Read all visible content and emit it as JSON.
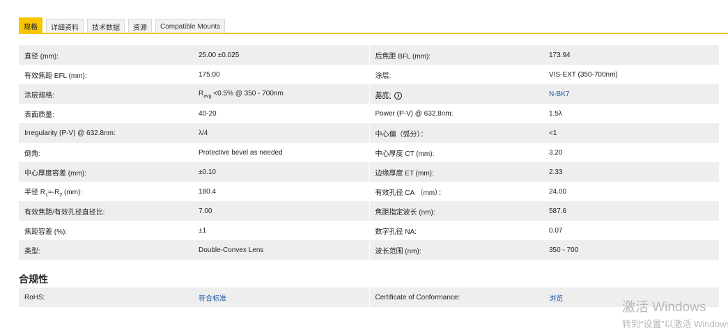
{
  "tabs": [
    {
      "label": "规格"
    },
    {
      "label": "详细资料"
    },
    {
      "label": "技术数据"
    },
    {
      "label": "资源"
    },
    {
      "label": "Compatible Mounts"
    }
  ],
  "spec_rows": [
    {
      "l1": "直径 (mm):",
      "v1": "25.00 ±0.025",
      "l2": "后焦距 BFL (mm):",
      "v2": "173.94"
    },
    {
      "l1": "有效焦距 EFL (mm):",
      "v1": "175.00",
      "l2": "涂层:",
      "v2": "VIS-EXT (350-700nm)"
    },
    {
      "l1": "涂层规格:",
      "v1_r": "R",
      "v1_sub": "avg",
      "v1_rest": " <0.5% @ 350 - 700nm",
      "l2": "基底:",
      "l2_icon": "i",
      "v2": "N-BK7"
    },
    {
      "l1": "表面质量:",
      "v1": "40-20",
      "l2": "Power (P-V) @ 632.8nm:",
      "v2": "1.5λ"
    },
    {
      "l1": "Irregularity (P-V) @ 632.8nm:",
      "v1": "λ/4",
      "l2": "中心偏（弧分）：",
      "v2": "<1"
    },
    {
      "l1": "倒角:",
      "v1": "Protective bevel as needed",
      "l2": "中心厚度 CT (mm):",
      "v2": "3.20"
    },
    {
      "l1": "中心厚度容差 (mm):",
      "v1": "±0.10",
      "l2": "边缘厚度 ET (mm):",
      "v2": "2.33"
    },
    {
      "l1_pre": "半径 R",
      "l1_s1": "1",
      "l1_mid": "=-R",
      "l1_s2": "2",
      "l1_post": " (mm):",
      "v1": "180.4",
      "l2": "有效孔径 CA （mm）：",
      "v2": "24.00"
    },
    {
      "l1": "有效焦距/有效孔径直径比:",
      "v1": "7.00",
      "l2": "焦距指定波长 (nm):",
      "v2": "587.6"
    },
    {
      "l1": "焦距容差 (%):",
      "v1": "±1",
      "l2": "数字孔径 NA:",
      "v2": "0.07"
    },
    {
      "l1": "类型:",
      "v1": "Double-Convex Lens",
      "l2": "波长范围 (nm):",
      "v2": "350 - 700"
    }
  ],
  "compliance": {
    "title": "合规性",
    "row": {
      "l1": "RoHS:",
      "v1": "符合标准",
      "l2": "Certificate of Conformance:",
      "v2": "浏览"
    }
  },
  "watermark": {
    "line1": "激活 Windows",
    "line2": "转到“设置”以激活 Windows。"
  },
  "colors": {
    "accent": "#f7c600",
    "link": "#1a5aa8",
    "row_shade": "#eeeeee"
  }
}
